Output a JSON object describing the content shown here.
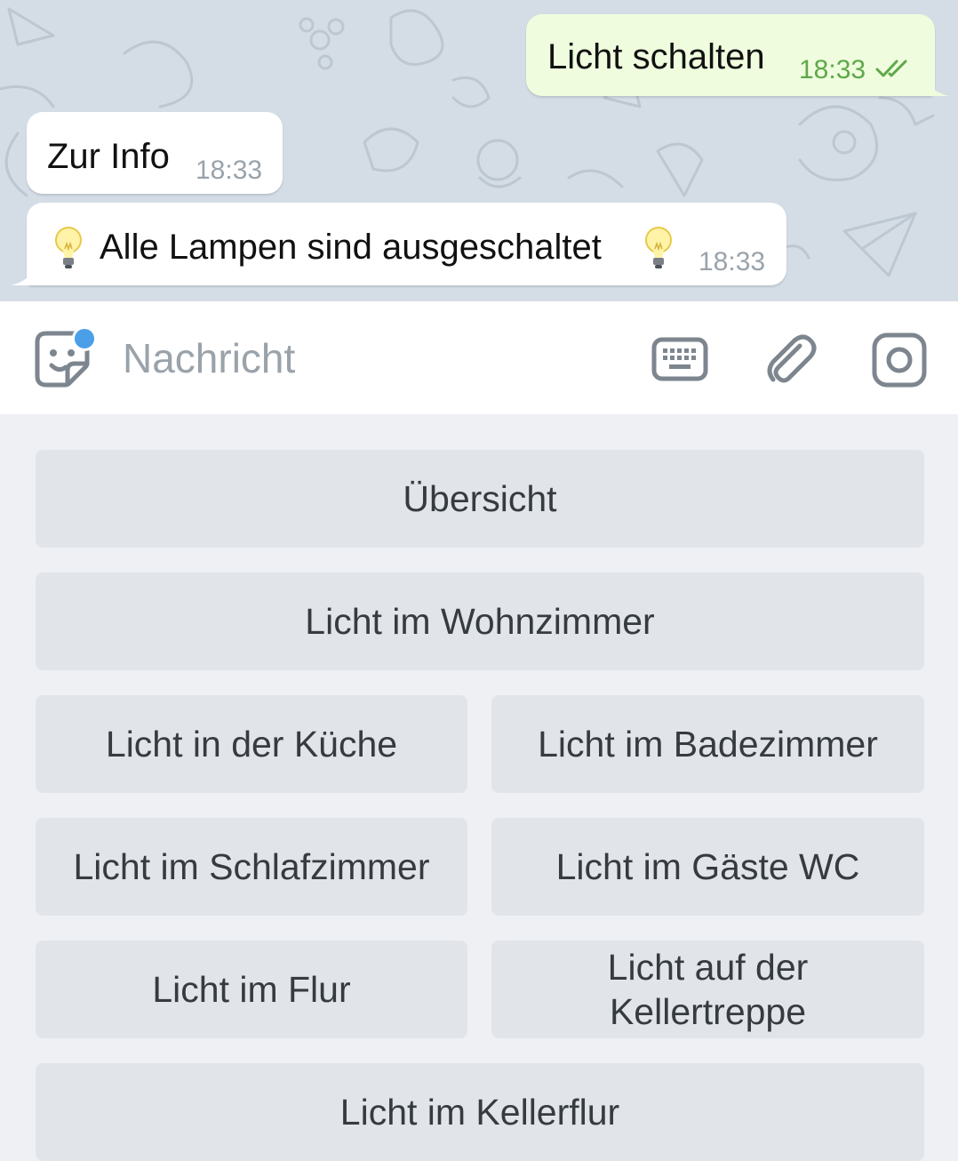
{
  "chat": {
    "messages": [
      {
        "direction": "outgoing",
        "text": "Licht schalten",
        "time": "18:33",
        "status": "read"
      },
      {
        "direction": "incoming",
        "text": "Zur Info",
        "time": "18:33"
      },
      {
        "direction": "incoming",
        "text": "Alle Lampen sind ausgeschaltet",
        "time": "18:33",
        "emoji_before": "💡",
        "emoji_after": "💡"
      }
    ]
  },
  "input_bar": {
    "placeholder": "Nachricht",
    "left_icon": "sticker-icon",
    "right_icons": [
      "keyboard-icon",
      "paperclip-icon",
      "camera-icon"
    ],
    "badge_color": "#4a9fe8"
  },
  "keyboard": {
    "rows": [
      [
        "Übersicht"
      ],
      [
        "Licht im Wohnzimmer"
      ],
      [
        "Licht in der Küche",
        "Licht im Badezimmer"
      ],
      [
        "Licht im Schlafzimmer",
        "Licht im Gäste WC"
      ],
      [
        "Licht im Flur",
        "Licht auf der Kellertreppe"
      ],
      [
        "Licht im Kellerflur"
      ]
    ]
  },
  "colors": {
    "chat_background": "#d4dde6",
    "outgoing_bubble": "#effdde",
    "incoming_bubble": "#ffffff",
    "read_check": "#5fa84a",
    "keyboard_button": "#e1e5ea",
    "keyboard_background": "#eef0f4"
  }
}
